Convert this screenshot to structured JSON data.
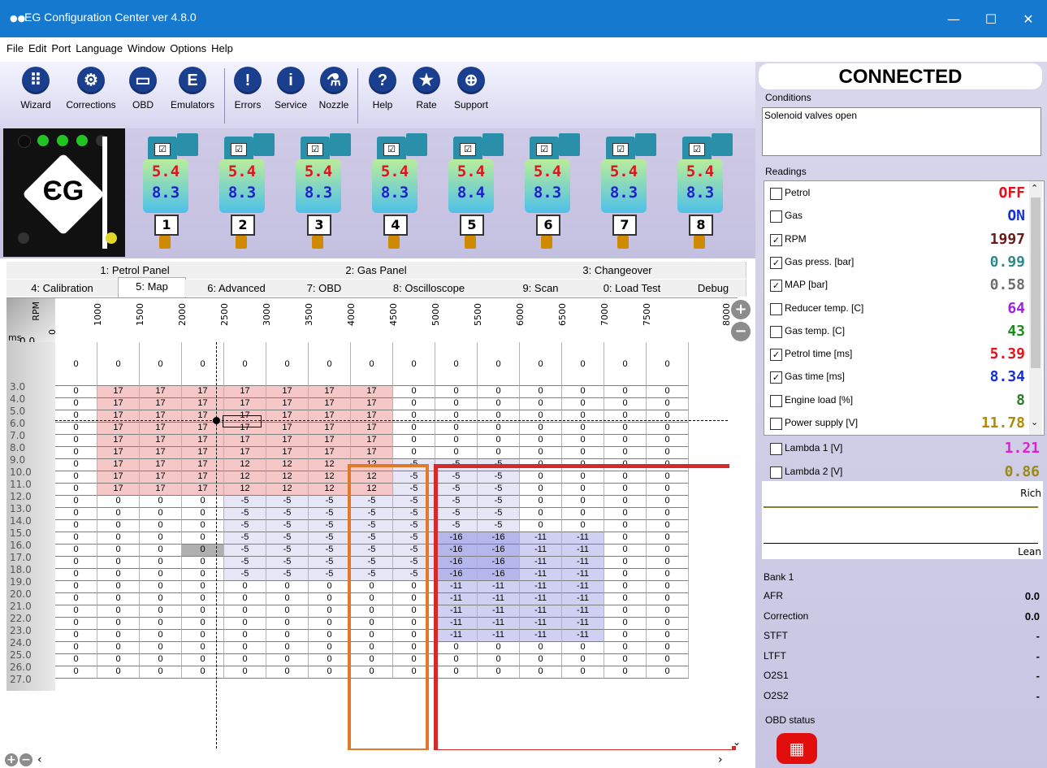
{
  "window": {
    "title": "EG Configuration Center ver 4.8.0"
  },
  "menu": [
    "File",
    "Edit",
    "Port",
    "Language",
    "Window",
    "Options",
    "Help"
  ],
  "toolbar": [
    {
      "label": "Wizard",
      "icon": "wizard-icon"
    },
    {
      "label": "Corrections",
      "icon": "corrections-icon"
    },
    {
      "label": "OBD",
      "icon": "obd-icon"
    },
    {
      "label": "Emulators",
      "icon": "emulators-icon"
    },
    {
      "label": "Errors",
      "icon": "errors-icon"
    },
    {
      "label": "Service",
      "icon": "service-icon"
    },
    {
      "label": "Nozzle",
      "icon": "nozzle-icon"
    },
    {
      "label": "Help",
      "icon": "help-icon"
    },
    {
      "label": "Rate",
      "icon": "rate-icon"
    },
    {
      "label": "Support",
      "icon": "support-icon"
    }
  ],
  "injectors": [
    {
      "petrol": "5.4",
      "gas": "8.3",
      "num": "1"
    },
    {
      "petrol": "5.4",
      "gas": "8.3",
      "num": "2"
    },
    {
      "petrol": "5.4",
      "gas": "8.3",
      "num": "3"
    },
    {
      "petrol": "5.4",
      "gas": "8.3",
      "num": "4"
    },
    {
      "petrol": "5.4",
      "gas": "8.4",
      "num": "5"
    },
    {
      "petrol": "5.4",
      "gas": "8.3",
      "num": "6"
    },
    {
      "petrol": "5.4",
      "gas": "8.3",
      "num": "7"
    },
    {
      "petrol": "5.4",
      "gas": "8.3",
      "num": "8"
    }
  ],
  "tabs_top": [
    "1: Petrol Panel",
    "2: Gas Panel",
    "3: Changeover"
  ],
  "tabs_bottom": [
    "4: Calibration",
    "5: Map",
    "6: Advanced",
    "7: OBD",
    "8: Oscilloscope",
    "9: Scan",
    "0: Load Test",
    "Debug"
  ],
  "map": {
    "rpm_label": "RPM",
    "ms_label": "ms",
    "rpm_ticks": [
      "0",
      "1000",
      "1500",
      "2000",
      "2500",
      "3000",
      "3500",
      "4000",
      "4500",
      "5000",
      "5500",
      "6000",
      "6500",
      "7000",
      "7500",
      "8000"
    ],
    "row_labels": [
      "0.0",
      "3.0",
      "4.0",
      "5.0",
      "6.0",
      "7.0",
      "8.0",
      "9.0",
      "10.0",
      "11.0",
      "12.0",
      "13.0",
      "14.0",
      "15.0",
      "16.0",
      "17.0",
      "18.0",
      "19.0",
      "20.0",
      "21.0",
      "22.0",
      "23.0",
      "24.0",
      "25.0",
      "26.0",
      "27.0"
    ],
    "rows": [
      [
        0,
        0,
        0,
        0,
        0,
        0,
        0,
        0,
        0,
        0,
        0,
        0,
        0,
        0,
        0
      ],
      [
        0,
        17,
        17,
        17,
        17,
        17,
        17,
        17,
        0,
        0,
        0,
        0,
        0,
        0,
        0
      ],
      [
        0,
        17,
        17,
        17,
        17,
        17,
        17,
        17,
        0,
        0,
        0,
        0,
        0,
        0,
        0
      ],
      [
        0,
        17,
        17,
        17,
        17,
        17,
        17,
        17,
        0,
        0,
        0,
        0,
        0,
        0,
        0
      ],
      [
        0,
        17,
        17,
        17,
        17,
        17,
        17,
        17,
        0,
        0,
        0,
        0,
        0,
        0,
        0
      ],
      [
        0,
        17,
        17,
        17,
        17,
        17,
        17,
        17,
        0,
        0,
        0,
        0,
        0,
        0,
        0
      ],
      [
        0,
        17,
        17,
        17,
        17,
        17,
        17,
        17,
        0,
        0,
        0,
        0,
        0,
        0,
        0
      ],
      [
        0,
        17,
        17,
        17,
        12,
        12,
        12,
        12,
        -5,
        -5,
        -5,
        0,
        0,
        0,
        0
      ],
      [
        0,
        17,
        17,
        17,
        12,
        12,
        12,
        12,
        -5,
        -5,
        -5,
        0,
        0,
        0,
        0
      ],
      [
        0,
        17,
        17,
        17,
        12,
        12,
        12,
        12,
        -5,
        -5,
        -5,
        0,
        0,
        0,
        0
      ],
      [
        0,
        0,
        0,
        0,
        -5,
        -5,
        -5,
        -5,
        -5,
        -5,
        -5,
        0,
        0,
        0,
        0
      ],
      [
        0,
        0,
        0,
        0,
        -5,
        -5,
        -5,
        -5,
        -5,
        -5,
        -5,
        0,
        0,
        0,
        0
      ],
      [
        0,
        0,
        0,
        0,
        -5,
        -5,
        -5,
        -5,
        -5,
        -5,
        -5,
        0,
        0,
        0,
        0
      ],
      [
        0,
        0,
        0,
        0,
        -5,
        -5,
        -5,
        -5,
        -5,
        -16,
        -16,
        -11,
        -11,
        0,
        0
      ],
      [
        0,
        0,
        0,
        0,
        -5,
        -5,
        -5,
        -5,
        -5,
        -16,
        -16,
        -11,
        -11,
        0,
        0
      ],
      [
        0,
        0,
        0,
        0,
        -5,
        -5,
        -5,
        -5,
        -5,
        -16,
        -16,
        -11,
        -11,
        0,
        0
      ],
      [
        0,
        0,
        0,
        0,
        -5,
        -5,
        -5,
        -5,
        -5,
        -16,
        -16,
        -11,
        -11,
        0,
        0
      ],
      [
        0,
        0,
        0,
        0,
        0,
        0,
        0,
        0,
        0,
        -11,
        -11,
        -11,
        -11,
        0,
        0
      ],
      [
        0,
        0,
        0,
        0,
        0,
        0,
        0,
        0,
        0,
        -11,
        -11,
        -11,
        -11,
        0,
        0
      ],
      [
        0,
        0,
        0,
        0,
        0,
        0,
        0,
        0,
        0,
        -11,
        -11,
        -11,
        -11,
        0,
        0
      ],
      [
        0,
        0,
        0,
        0,
        0,
        0,
        0,
        0,
        0,
        -11,
        -11,
        -11,
        -11,
        0,
        0
      ],
      [
        0,
        0,
        0,
        0,
        0,
        0,
        0,
        0,
        0,
        -11,
        -11,
        -11,
        -11,
        0,
        0
      ],
      [
        0,
        0,
        0,
        0,
        0,
        0,
        0,
        0,
        0,
        0,
        0,
        0,
        0,
        0,
        0
      ],
      [
        0,
        0,
        0,
        0,
        0,
        0,
        0,
        0,
        0,
        0,
        0,
        0,
        0,
        0,
        0
      ],
      [
        0,
        0,
        0,
        0,
        0,
        0,
        0,
        0,
        0,
        0,
        0,
        0,
        0,
        0,
        0
      ]
    ]
  },
  "status": {
    "connected": "CONNECTED"
  },
  "conditions": {
    "label": "Conditions",
    "text": "Solenoid valves open"
  },
  "readings": {
    "label": "Readings",
    "items": [
      {
        "label": "Petrol",
        "value": "OFF",
        "color": "#e8101b",
        "checked": false
      },
      {
        "label": "Gas",
        "value": "ON",
        "color": "#1530d8",
        "checked": false
      },
      {
        "label": "RPM",
        "value": "1997",
        "color": "#6b1a1a",
        "checked": true
      },
      {
        "label": "Gas press. [bar]",
        "value": "0.99",
        "color": "#2c8a8a",
        "checked": true
      },
      {
        "label": "MAP [bar]",
        "value": "0.58",
        "color": "#6e6e6e",
        "checked": true
      },
      {
        "label": "Reducer temp. [C]",
        "value": "64",
        "color": "#a020e0",
        "checked": false
      },
      {
        "label": "Gas temp. [C]",
        "value": "43",
        "color": "#1c8a1c",
        "checked": false
      },
      {
        "label": "Petrol time [ms]",
        "value": "5.39",
        "color": "#e8101b",
        "checked": true
      },
      {
        "label": "Gas time [ms]",
        "value": "8.34",
        "color": "#1530d8",
        "checked": true
      },
      {
        "label": "Engine load [%]",
        "value": "8",
        "color": "#2c7a2c",
        "checked": false
      },
      {
        "label": "Power supply [V]",
        "value": "11.78",
        "color": "#b08a00",
        "checked": false
      }
    ]
  },
  "lambda": [
    {
      "label": "Lambda 1 [V]",
      "value": "1.21",
      "color": "#e020d0"
    },
    {
      "label": "Lambda 2 [V]",
      "value": "0.86",
      "color": "#9a8a1a"
    }
  ],
  "lambda_graph": {
    "rich": "Rich",
    "lean": "Lean"
  },
  "obd": {
    "bank": "Bank 1",
    "rows": [
      {
        "label": "AFR",
        "value": "0.0"
      },
      {
        "label": "Correction",
        "value": "0.0"
      },
      {
        "label": "STFT",
        "value": "-"
      },
      {
        "label": "LTFT",
        "value": "-"
      },
      {
        "label": "O2S1",
        "value": "-"
      },
      {
        "label": "O2S2",
        "value": "-"
      }
    ],
    "status_label": "OBD status"
  }
}
